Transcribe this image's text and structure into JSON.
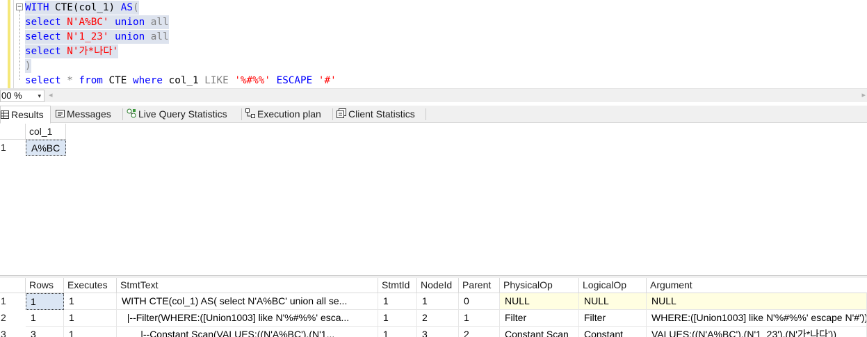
{
  "editor": {
    "collapse_glyph": "−",
    "lines": [
      {
        "tokens": [
          {
            "t": "WITH ",
            "c": "kw"
          },
          {
            "t": "CTE(col_1) ",
            "c": "plain"
          },
          {
            "t": "AS",
            "c": "kw"
          },
          {
            "t": "(",
            "c": "gry"
          }
        ]
      },
      {
        "tokens": [
          {
            "t": "select ",
            "c": "kw"
          },
          {
            "t": "N'A%BC' ",
            "c": "str"
          },
          {
            "t": "union ",
            "c": "kw"
          },
          {
            "t": "all",
            "c": "gry"
          }
        ]
      },
      {
        "tokens": [
          {
            "t": "select ",
            "c": "kw"
          },
          {
            "t": "N'1_23' ",
            "c": "str"
          },
          {
            "t": "union ",
            "c": "kw"
          },
          {
            "t": "all",
            "c": "gry"
          }
        ]
      },
      {
        "tokens": [
          {
            "t": "select ",
            "c": "kw"
          },
          {
            "t": "N'가*나다'",
            "c": "str"
          }
        ]
      },
      {
        "tokens": [
          {
            "t": ")",
            "c": "gry"
          }
        ]
      },
      {
        "tokens": [
          {
            "t": "select ",
            "c": "kw"
          },
          {
            "t": "* ",
            "c": "gry"
          },
          {
            "t": "from ",
            "c": "kw"
          },
          {
            "t": "CTE ",
            "c": "plain"
          },
          {
            "t": "where ",
            "c": "kw"
          },
          {
            "t": "col_1 ",
            "c": "plain"
          },
          {
            "t": "LIKE ",
            "c": "gry"
          },
          {
            "t": "'%#%%' ",
            "c": "str"
          },
          {
            "t": "ESCAPE ",
            "c": "kw"
          },
          {
            "t": "'#'",
            "c": "str"
          }
        ]
      }
    ]
  },
  "zoom": {
    "value": "00 %",
    "caret": "▾"
  },
  "scroll": {
    "left_arrow": "◂",
    "right_arrow": "▸"
  },
  "tabs": [
    {
      "label": "Results",
      "icon": "grid-icon"
    },
    {
      "label": "Messages",
      "icon": "messages-icon"
    },
    {
      "label": "Live Query Statistics",
      "icon": "live-query-icon"
    },
    {
      "label": "Execution plan",
      "icon": "execution-plan-icon"
    },
    {
      "label": "Client Statistics",
      "icon": "client-statistics-icon"
    }
  ],
  "results": {
    "columns": [
      "col_1"
    ],
    "rows": [
      {
        "num": "1",
        "cells": [
          "A%BC"
        ]
      }
    ]
  },
  "stats": {
    "columns": [
      "Rows",
      "Executes",
      "StmtText",
      "StmtId",
      "NodeId",
      "Parent",
      "PhysicalOp",
      "LogicalOp",
      "Argument"
    ],
    "rows": [
      {
        "num": "1",
        "cells": [
          "1",
          "1",
          "WITH CTE(col_1) AS(  select N'A%BC' union all  se...",
          "1",
          "1",
          "0",
          "NULL",
          "NULL",
          "NULL"
        ]
      },
      {
        "num": "2",
        "cells": [
          "1",
          "1",
          "  |--Filter(WHERE:([Union1003] like N'%#%%' esca...",
          "1",
          "2",
          "1",
          "Filter",
          "Filter",
          "WHERE:([Union1003] like N'%#%%' escape N'#'))"
        ]
      },
      {
        "num": "3",
        "cells": [
          "3",
          "1",
          "       |--Constant Scan(VALUES:((N'A%BC'),(N'1...",
          "1",
          "3",
          "2",
          "Constant Scan",
          "Constant",
          "VALUES:((N'A%BC'),(N'1_23'),(N'가*나다'))"
        ]
      }
    ]
  },
  "colors": {
    "selection": "#dde3ee",
    "keyword": "#0000ff",
    "string": "#ff0000",
    "null_cell": "#fffee1",
    "focus_cell": "#dbe6f4"
  }
}
